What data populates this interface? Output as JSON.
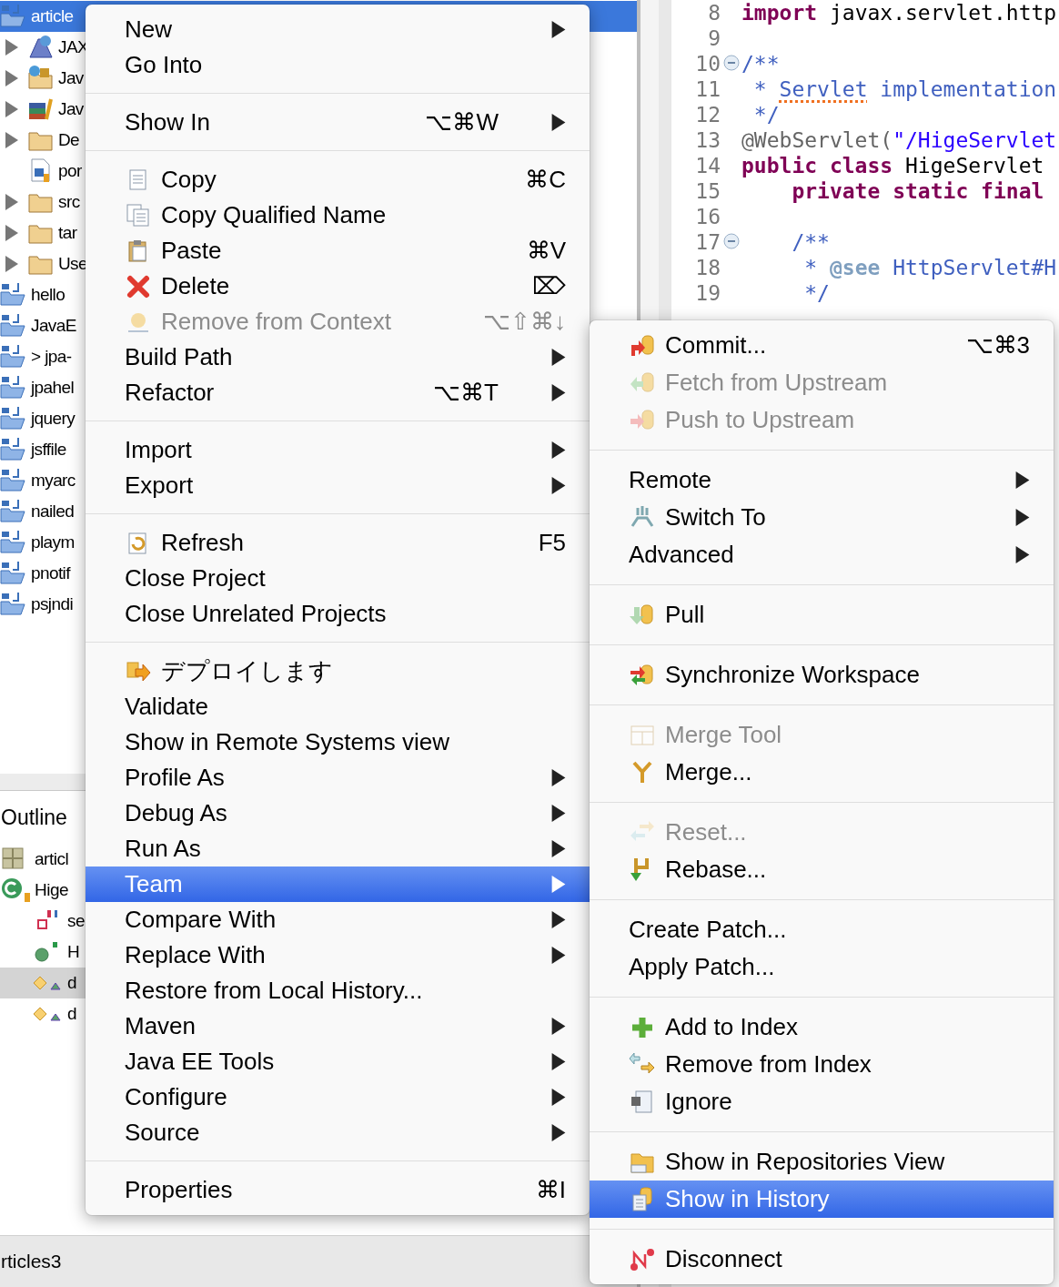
{
  "project_explorer": {
    "items": [
      {
        "label": "article",
        "kind": "project",
        "selected": true,
        "children": [
          {
            "label": "JAX",
            "kind": "service",
            "has_children": true,
            "selected": false
          },
          {
            "label": "Jav",
            "kind": "web",
            "has_children": true,
            "selected": false
          },
          {
            "label": "Jav",
            "kind": "library",
            "has_children": true,
            "selected": false
          },
          {
            "label": "De",
            "kind": "folder",
            "has_children": true,
            "selected": false
          },
          {
            "label": "por",
            "kind": "file",
            "has_children": false,
            "selected": false
          },
          {
            "label": "src",
            "kind": "folder",
            "has_children": true,
            "selected": false
          },
          {
            "label": "tar",
            "kind": "folder",
            "has_children": true,
            "selected": false
          },
          {
            "label": "Use",
            "kind": "folder",
            "has_children": true,
            "selected": false
          }
        ]
      },
      {
        "label": "hello",
        "kind": "project",
        "selected": false
      },
      {
        "label": "JavaE",
        "kind": "project",
        "selected": false
      },
      {
        "label": "> jpa-",
        "kind": "project",
        "selected": false
      },
      {
        "label": "jpahel",
        "kind": "project",
        "selected": false
      },
      {
        "label": "jquery",
        "kind": "project",
        "selected": false
      },
      {
        "label": "jsffile",
        "kind": "project",
        "selected": false
      },
      {
        "label": "myarc",
        "kind": "project",
        "selected": false
      },
      {
        "label": "nailed",
        "kind": "project",
        "selected": false
      },
      {
        "label": "playm",
        "kind": "project",
        "selected": false
      },
      {
        "label": "pnotif",
        "kind": "project",
        "selected": false
      },
      {
        "label": "psjndi",
        "kind": "project",
        "selected": false
      }
    ]
  },
  "outline": {
    "title": "Outline",
    "items": [
      {
        "label": "articl",
        "kind": "package",
        "selected": false
      },
      {
        "label": "Hige",
        "kind": "class",
        "selected": false,
        "children": [
          {
            "label": "se",
            "kind": "field",
            "selected": false
          },
          {
            "label": "H",
            "kind": "constructor",
            "selected": false
          },
          {
            "label": "d",
            "kind": "method",
            "selected": true
          },
          {
            "label": "d",
            "kind": "method",
            "selected": false
          }
        ]
      }
    ]
  },
  "status_bar": {
    "text": "rticles3"
  },
  "editor": {
    "lines": [
      {
        "number": "8",
        "fold": false,
        "tokens": [
          {
            "text": "import",
            "kind": "keyword"
          },
          {
            "text": " javax.servlet.http",
            "kind": "plain"
          }
        ]
      },
      {
        "number": "9",
        "fold": false
      },
      {
        "number": "10",
        "fold": true,
        "tokens": [
          {
            "text": "/**",
            "kind": "javadoc"
          }
        ]
      },
      {
        "number": "11",
        "fold": false,
        "tokens": [
          {
            "text": " * ",
            "kind": "javadoc"
          },
          {
            "text": "Servlet",
            "kind": "misspelled"
          },
          {
            "text": " implementation",
            "kind": "javadoc"
          }
        ]
      },
      {
        "number": "12",
        "fold": false,
        "tokens": [
          {
            "text": " */",
            "kind": "javadoc"
          }
        ]
      },
      {
        "number": "13",
        "fold": false,
        "tokens": [
          {
            "text": "@WebServlet(",
            "kind": "annotation"
          },
          {
            "text": "\"/HigeServlet",
            "kind": "string"
          }
        ]
      },
      {
        "number": "14",
        "fold": false,
        "tokens": [
          {
            "text": "public class",
            "kind": "keyword"
          },
          {
            "text": " HigeServlet",
            "kind": "plain"
          }
        ]
      },
      {
        "number": "15",
        "fold": false,
        "tokens": [
          {
            "text": "    private static final",
            "kind": "keyword"
          }
        ]
      },
      {
        "number": "16",
        "fold": false
      },
      {
        "number": "17",
        "fold": true,
        "tokens": [
          {
            "text": "    /**",
            "kind": "javadoc"
          }
        ]
      },
      {
        "number": "18",
        "fold": false,
        "tokens": [
          {
            "text": "     * ",
            "kind": "javadoc"
          },
          {
            "text": "@see",
            "kind": "tag"
          },
          {
            "text": " HttpServlet#H",
            "kind": "javadoc"
          }
        ]
      },
      {
        "number": "19",
        "fold": false,
        "tokens": [
          {
            "text": "     */",
            "kind": "javadoc"
          }
        ]
      }
    ]
  },
  "context_menu": {
    "groups": [
      [
        {
          "label": "New",
          "kind": "plain",
          "submenu": true,
          "disabled": false,
          "selected": false
        },
        {
          "label": "Go Into",
          "kind": "plain",
          "submenu": false,
          "disabled": false,
          "selected": false
        }
      ],
      [
        {
          "label": "Show In",
          "shortcut": "⌥⌘W",
          "kind": "plain",
          "submenu": true,
          "disabled": false,
          "selected": false
        }
      ],
      [
        {
          "label": "Copy",
          "shortcut": "⌘C",
          "kind": "copy",
          "submenu": false,
          "disabled": false,
          "selected": false
        },
        {
          "label": "Copy Qualified Name",
          "kind": "copy_name",
          "submenu": false,
          "disabled": false,
          "selected": false
        },
        {
          "label": "Paste",
          "shortcut": "⌘V",
          "kind": "paste",
          "submenu": false,
          "disabled": false,
          "selected": false
        },
        {
          "label": "Delete",
          "shortcut": "⌦",
          "kind": "delete",
          "submenu": false,
          "disabled": false,
          "selected": false
        },
        {
          "label": "Remove from Context",
          "shortcut": "⌥⇧⌘↓",
          "kind": "context",
          "submenu": false,
          "disabled": true,
          "selected": false
        },
        {
          "label": "Build Path",
          "kind": "plain",
          "submenu": true,
          "disabled": false,
          "selected": false
        },
        {
          "label": "Refactor",
          "shortcut": "⌥⌘T",
          "kind": "plain",
          "submenu": true,
          "disabled": false,
          "selected": false
        }
      ],
      [
        {
          "label": "Import",
          "kind": "plain",
          "submenu": true,
          "disabled": false,
          "selected": false
        },
        {
          "label": "Export",
          "kind": "plain",
          "submenu": true,
          "disabled": false,
          "selected": false
        }
      ],
      [
        {
          "label": "Refresh",
          "shortcut": "F5",
          "kind": "refresh",
          "submenu": false,
          "disabled": false,
          "selected": false
        },
        {
          "label": "Close Project",
          "kind": "plain",
          "submenu": false,
          "disabled": false,
          "selected": false
        },
        {
          "label": "Close Unrelated Projects",
          "kind": "plain",
          "submenu": false,
          "disabled": false,
          "selected": false
        }
      ],
      [
        {
          "label": "デプロイします",
          "kind": "deploy",
          "submenu": false,
          "disabled": false,
          "selected": false
        },
        {
          "label": "Validate",
          "kind": "plain",
          "submenu": false,
          "disabled": false,
          "selected": false
        },
        {
          "label": "Show in Remote Systems view",
          "kind": "plain",
          "submenu": false,
          "disabled": false,
          "selected": false
        },
        {
          "label": "Profile As",
          "kind": "plain",
          "submenu": true,
          "disabled": false,
          "selected": false
        },
        {
          "label": "Debug As",
          "kind": "plain",
          "submenu": true,
          "disabled": false,
          "selected": false
        },
        {
          "label": "Run As",
          "kind": "plain",
          "submenu": true,
          "disabled": false,
          "selected": false
        },
        {
          "label": "Team",
          "kind": "plain",
          "submenu": true,
          "disabled": false,
          "selected": true
        },
        {
          "label": "Compare With",
          "kind": "plain",
          "submenu": true,
          "disabled": false,
          "selected": false
        },
        {
          "label": "Replace With",
          "kind": "plain",
          "submenu": true,
          "disabled": false,
          "selected": false
        },
        {
          "label": "Restore from Local History...",
          "kind": "plain",
          "submenu": false,
          "disabled": false,
          "selected": false
        },
        {
          "label": "Maven",
          "kind": "plain",
          "submenu": true,
          "disabled": false,
          "selected": false
        },
        {
          "label": "Java EE Tools",
          "kind": "plain",
          "submenu": true,
          "disabled": false,
          "selected": false
        },
        {
          "label": "Configure",
          "kind": "plain",
          "submenu": true,
          "disabled": false,
          "selected": false
        },
        {
          "label": "Source",
          "kind": "plain",
          "submenu": true,
          "disabled": false,
          "selected": false
        }
      ],
      [
        {
          "label": "Properties",
          "shortcut": "⌘I",
          "kind": "plain",
          "submenu": false,
          "disabled": false,
          "selected": false
        }
      ]
    ]
  },
  "team_submenu": {
    "groups": [
      [
        {
          "label": "Commit...",
          "shortcut": "⌥⌘3",
          "kind": "commit",
          "submenu": false,
          "disabled": false,
          "selected": false
        },
        {
          "label": "Fetch from Upstream",
          "kind": "fetch",
          "submenu": false,
          "disabled": true,
          "selected": false
        },
        {
          "label": "Push to Upstream",
          "kind": "push",
          "submenu": false,
          "disabled": true,
          "selected": false
        }
      ],
      [
        {
          "label": "Remote",
          "kind": "plain",
          "submenu": true,
          "disabled": false,
          "selected": false
        },
        {
          "label": "Switch To",
          "kind": "switch",
          "submenu": true,
          "disabled": false,
          "selected": false
        },
        {
          "label": "Advanced",
          "kind": "plain",
          "submenu": true,
          "disabled": false,
          "selected": false
        }
      ],
      [
        {
          "label": "Pull",
          "kind": "pull",
          "submenu": false,
          "disabled": false,
          "selected": false
        }
      ],
      [
        {
          "label": "Synchronize Workspace",
          "kind": "sync",
          "submenu": false,
          "disabled": false,
          "selected": false
        }
      ],
      [
        {
          "label": "Merge Tool",
          "kind": "merge_tool",
          "submenu": false,
          "disabled": true,
          "selected": false
        },
        {
          "label": "Merge...",
          "kind": "merge",
          "submenu": false,
          "disabled": false,
          "selected": false
        }
      ],
      [
        {
          "label": "Reset...",
          "kind": "reset",
          "submenu": false,
          "disabled": true,
          "selected": false
        },
        {
          "label": "Rebase...",
          "kind": "rebase",
          "submenu": false,
          "disabled": false,
          "selected": false
        }
      ],
      [
        {
          "label": "Create Patch...",
          "kind": "plain",
          "submenu": false,
          "disabled": false,
          "selected": false
        },
        {
          "label": "Apply Patch...",
          "kind": "plain",
          "submenu": false,
          "disabled": false,
          "selected": false
        }
      ],
      [
        {
          "label": "Add to Index",
          "kind": "add",
          "submenu": false,
          "disabled": false,
          "selected": false
        },
        {
          "label": "Remove from Index",
          "kind": "remove_index",
          "submenu": false,
          "disabled": false,
          "selected": false
        },
        {
          "label": "Ignore",
          "kind": "ignore",
          "submenu": false,
          "disabled": false,
          "selected": false
        }
      ],
      [
        {
          "label": "Show in Repositories View",
          "kind": "repositories",
          "submenu": false,
          "disabled": false,
          "selected": false
        },
        {
          "label": "Show in History",
          "kind": "history",
          "submenu": false,
          "disabled": false,
          "selected": true
        }
      ],
      [
        {
          "label": "Disconnect",
          "kind": "disconnect",
          "submenu": false,
          "disabled": false,
          "selected": false
        }
      ]
    ]
  }
}
